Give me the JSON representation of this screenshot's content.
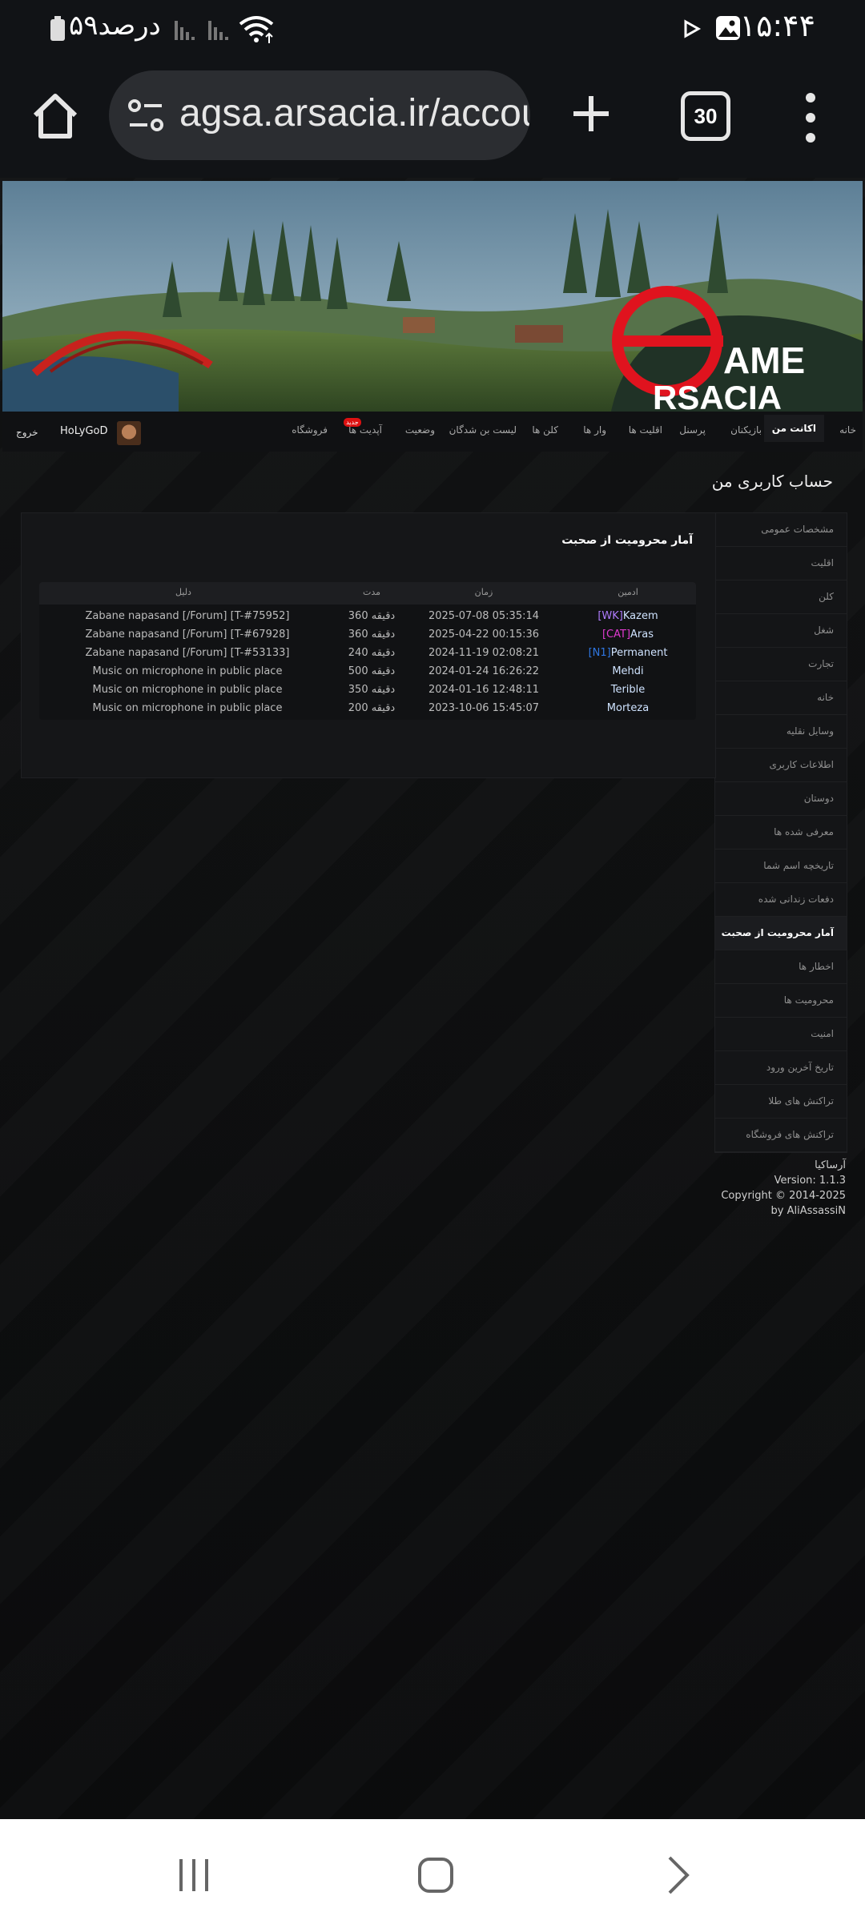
{
  "status_bar": {
    "time": "۱۵:۴۴",
    "battery_text": "۵۹درصد",
    "icons": [
      "play-icon",
      "gallery-icon",
      "wifi-icon",
      "signal-icon",
      "battery-icon"
    ]
  },
  "browser": {
    "url": "agsa.arsacia.ir/account",
    "tab_count": "30",
    "icons": [
      "home-icon",
      "site-settings-icon",
      "new-tab-icon",
      "menu-icon"
    ]
  },
  "banner": {
    "logo_line1": "AME",
    "logo_line2": "RSACIA",
    "accent_color": "#e0131e"
  },
  "top_nav": {
    "items": [
      {
        "label": "خانه"
      },
      {
        "label": "اکانت من"
      },
      {
        "label": "بازیکنان"
      },
      {
        "label": "پرسنل"
      },
      {
        "label": "اقلیت ها"
      },
      {
        "label": "وار ها"
      },
      {
        "label": "کلن ها"
      },
      {
        "label": "لیست بن شدگان"
      },
      {
        "label": "وضعیت"
      },
      {
        "label": "آپدیت ها",
        "badge": "جدید"
      },
      {
        "label": "فروشگاه"
      }
    ],
    "username": "HoLyGoD",
    "logout": "خروج"
  },
  "page_title": "حساب کاربری من",
  "sidebar": {
    "items": [
      {
        "label": "مشخصات عمومی"
      },
      {
        "label": "اقلیت"
      },
      {
        "label": "کلن"
      },
      {
        "label": "شغل"
      },
      {
        "label": "تجارت"
      },
      {
        "label": "خانه"
      },
      {
        "label": "وسایل نقلیه"
      },
      {
        "label": "اطلاعات کاربری"
      },
      {
        "label": "دوستان"
      },
      {
        "label": "معرفی شده ها"
      },
      {
        "label": "تاریخچه اسم شما"
      },
      {
        "label": "دفعات زندانی شده"
      },
      {
        "label": "آمار محرومیت از صحبت"
      },
      {
        "label": "اخطار ها"
      },
      {
        "label": "محرومیت ها"
      },
      {
        "label": "امنیت"
      },
      {
        "label": "تاریخ آخرین ورود"
      },
      {
        "label": "تراکنش های طلا"
      },
      {
        "label": "تراکنش های فروشگاه"
      }
    ]
  },
  "content": {
    "title": "آمار محرومیت از صحبت",
    "columns": {
      "admin": "ادمین",
      "time": "زمان",
      "duration": "مدت",
      "reason": "دلیل"
    },
    "rows": [
      {
        "tag": "[WK]",
        "tag_color": "#b07cff",
        "admin": "Kazem",
        "time": "2025-07-08 05:35:14",
        "duration": "360 دقیقه",
        "reason": "Zabane napasand [/Forum] [T-#75952]"
      },
      {
        "tag": "[CAT]",
        "tag_color": "#e03ad0",
        "admin": "Aras",
        "time": "2025-04-22 00:15:36",
        "duration": "360 دقیقه",
        "reason": "Zabane napasand [/Forum] [T-#67928]"
      },
      {
        "tag": "[N1]",
        "tag_color": "#2f76e0",
        "admin": "Permanent",
        "time": "2024-11-19 02:08:21",
        "duration": "240 دقیقه",
        "reason": "Zabane napasand [/Forum] [T-#53133]"
      },
      {
        "tag": "",
        "tag_color": "",
        "admin": "Mehdi",
        "time": "2024-01-24 16:26:22",
        "duration": "500 دقیقه",
        "reason": "Music on microphone in public place"
      },
      {
        "tag": "",
        "tag_color": "",
        "admin": "Terible",
        "time": "2024-01-16 12:48:11",
        "duration": "350 دقیقه",
        "reason": "Music on microphone in public place"
      },
      {
        "tag": "",
        "tag_color": "",
        "admin": "Morteza",
        "time": "2023-10-06 15:45:07",
        "duration": "200 دقیقه",
        "reason": "Music on microphone in public place"
      }
    ]
  },
  "footer": {
    "site": "آرساکیا",
    "version": "Version: 1.1.3",
    "copyright": "Copyright © 2014-2025",
    "author": "by AliAssassiN"
  }
}
